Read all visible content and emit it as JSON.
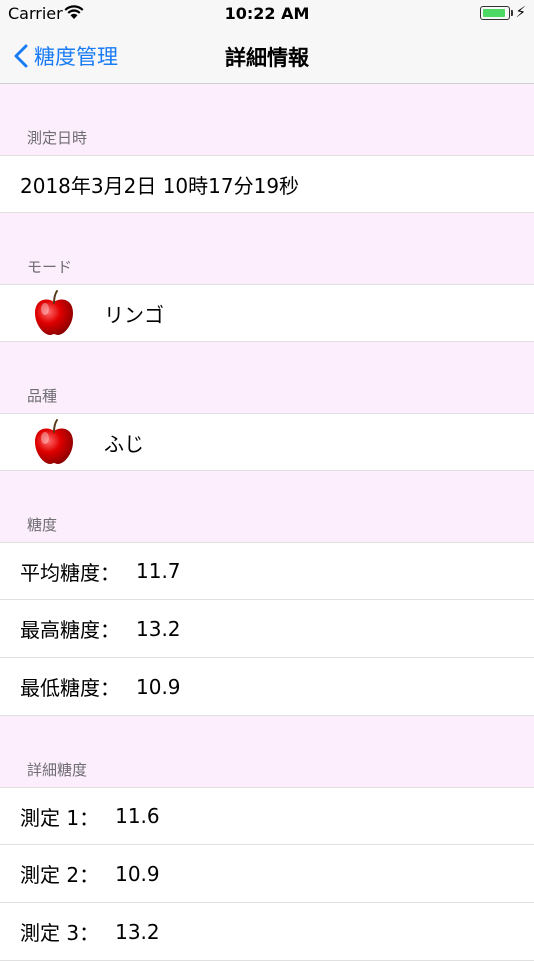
{
  "status": {
    "carrier": "Carrier",
    "time": "10:22 AM",
    "battery_level": 0.9
  },
  "nav": {
    "back_label": "糖度管理",
    "title": "詳細情報"
  },
  "sections": {
    "datetime": {
      "header": "測定日時",
      "value": "2018年3月2日 10時17分19秒"
    },
    "mode": {
      "header": "モード",
      "value": "リンゴ",
      "icon": "apple-icon"
    },
    "variety": {
      "header": "品種",
      "value": "ふじ",
      "icon": "apple-icon"
    },
    "sugar": {
      "header": "糖度",
      "rows": [
        {
          "label": "平均糖度：",
          "value": "11.7"
        },
        {
          "label": "最高糖度：",
          "value": "13.2"
        },
        {
          "label": "最低糖度：",
          "value": "10.9"
        }
      ]
    },
    "detail": {
      "header": "詳細糖度",
      "rows": [
        {
          "label": "測定 1：",
          "value": "11.6"
        },
        {
          "label": "測定 2：",
          "value": "10.9"
        },
        {
          "label": "測定 3：",
          "value": "13.2"
        }
      ]
    }
  },
  "colors": {
    "accent": "#1a7cf5",
    "background": "#fdeefd",
    "apple": "#d60000"
  }
}
